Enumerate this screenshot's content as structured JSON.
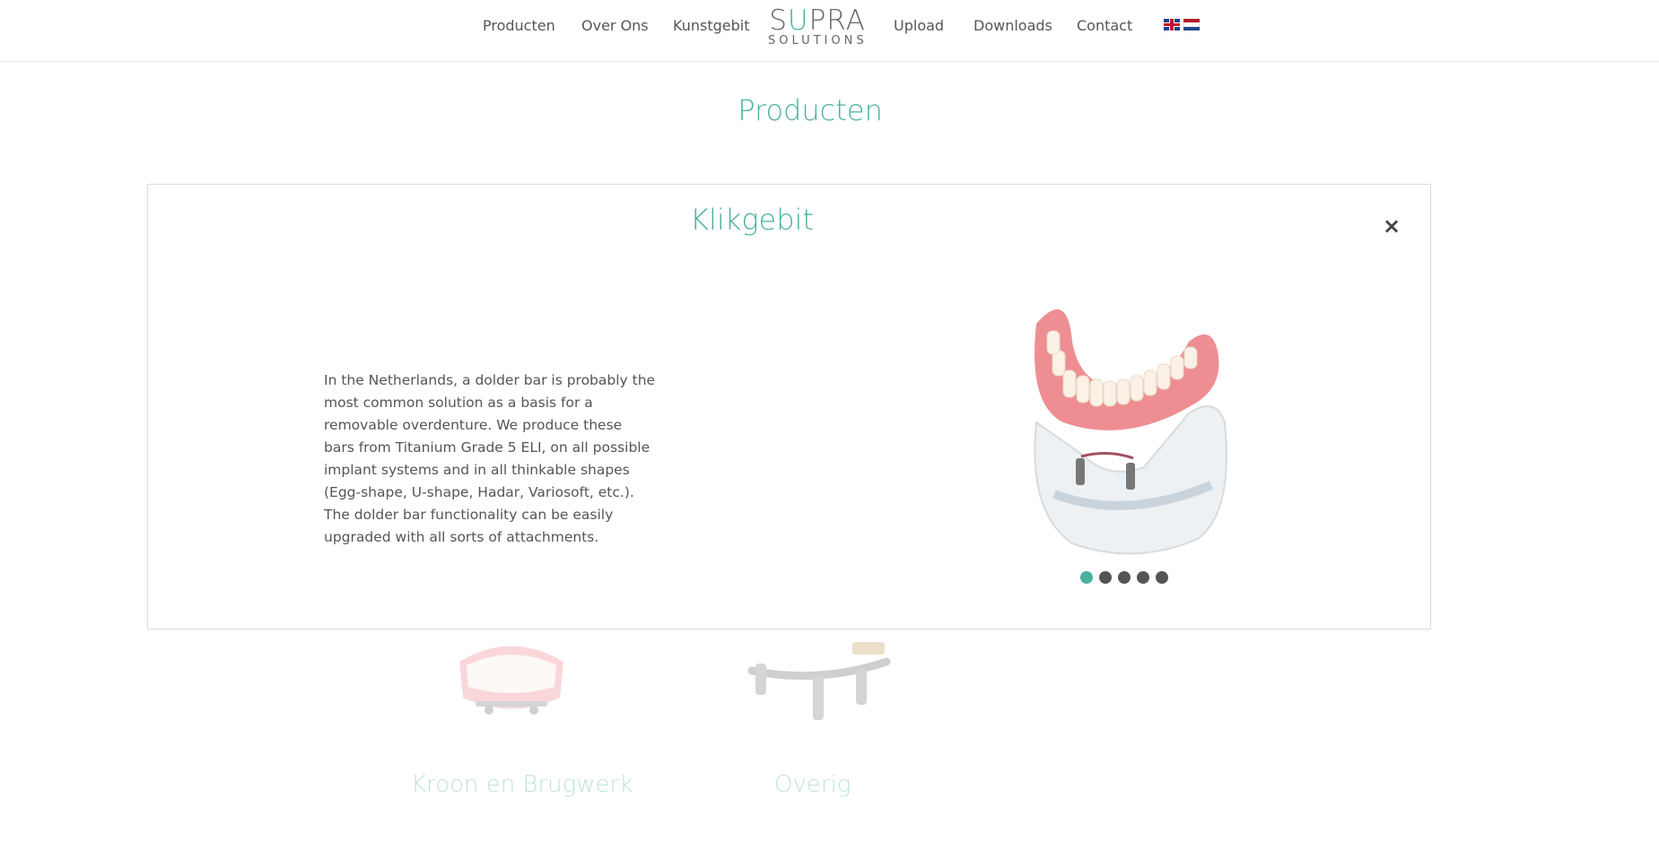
{
  "nav": {
    "left_items": [
      "Producten",
      "Over Ons",
      "Kunstgebit"
    ],
    "right_items": [
      "Upload",
      "Downloads",
      "Contact"
    ],
    "logo_main": "SUPRA",
    "logo_sub": "SOLUTIONS",
    "flags": [
      "uk-flag-icon",
      "nl-flag-icon"
    ]
  },
  "page": {
    "title": "Producten"
  },
  "modal": {
    "title": "Klikgebit",
    "close_label": "×",
    "description": "In the Netherlands, a dolder bar is probably the most common solution as a basis for a removable overdenture. We produce these bars from Titanium Grade 5 ELI, on all possible implant systems and in all thinkable shapes (Egg-shape, U-shape, Hadar, Variosoft, etc.). The dolder bar functionality can be easily upgraded with all sorts of attachments.",
    "carousel_total": 5,
    "carousel_active": 1
  },
  "categories": [
    {
      "label": "Kroon en Brugwerk",
      "icon": "denture-bridge-image"
    },
    {
      "label": "Overig",
      "icon": "implant-bar-image"
    }
  ],
  "colors": {
    "accent": "#4ab0a0",
    "text": "#555555",
    "border": "#dcdcdc"
  }
}
